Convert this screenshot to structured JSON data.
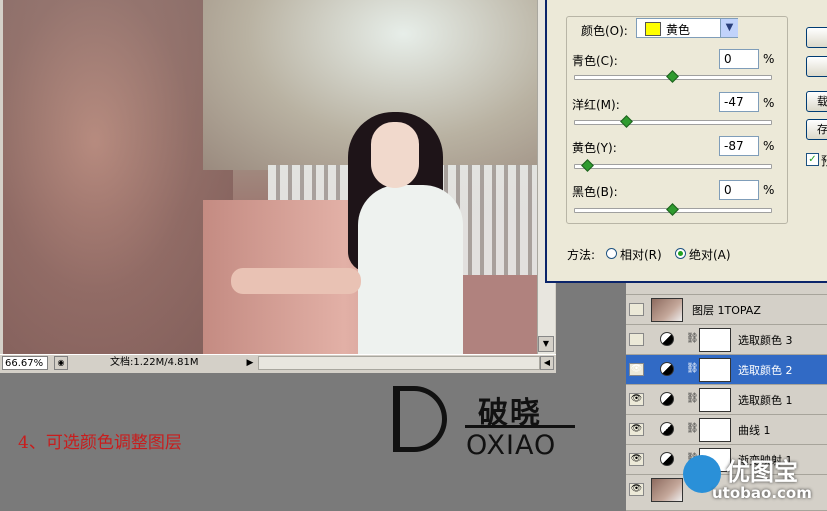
{
  "status_bar": {
    "zoom": "66.67%",
    "doc_size": "文档:1.22M/4.81M"
  },
  "dialog": {
    "colors_label": "颜色(O):",
    "selected_color": "黄色",
    "swatch_color": "#ffff00",
    "sliders": [
      {
        "label": "青色(C):",
        "value": "0",
        "unit": "%",
        "level": 0
      },
      {
        "label": "洋红(M):",
        "value": "-47",
        "unit": "%",
        "level": -47
      },
      {
        "label": "黄色(Y):",
        "value": "-87",
        "unit": "%",
        "level": -87
      },
      {
        "label": "黑色(B):",
        "value": "0",
        "unit": "%",
        "level": 0
      }
    ],
    "method_label": "方法:",
    "method_options": [
      {
        "label": "相对(R)",
        "selected": false
      },
      {
        "label": "绝对(A)",
        "selected": true
      }
    ],
    "side_buttons": [
      "",
      "",
      "载",
      "存"
    ],
    "preview_label": "预",
    "preview_checked": true
  },
  "layers": [
    {
      "name": "图层 1TOPAZ",
      "visible": false,
      "type": "image",
      "selected": false
    },
    {
      "name": "选取颜色 3",
      "visible": false,
      "type": "adjustment",
      "selected": false
    },
    {
      "name": "选取颜色 2",
      "visible": true,
      "type": "adjustment",
      "selected": true
    },
    {
      "name": "选取颜色 1",
      "visible": true,
      "type": "adjustment",
      "selected": false
    },
    {
      "name": "曲线 1",
      "visible": true,
      "type": "adjustment",
      "selected": false
    },
    {
      "name": "渐变映射 1",
      "visible": true,
      "type": "adjustment",
      "selected": false
    },
    {
      "name": "",
      "visible": true,
      "type": "image",
      "selected": false
    }
  ],
  "caption": "4、可选颜色调整图层",
  "logo": {
    "cn": "破晓",
    "en": "OXIAO"
  },
  "watermark": {
    "cn": "优图宝",
    "en": "utobao.com"
  }
}
